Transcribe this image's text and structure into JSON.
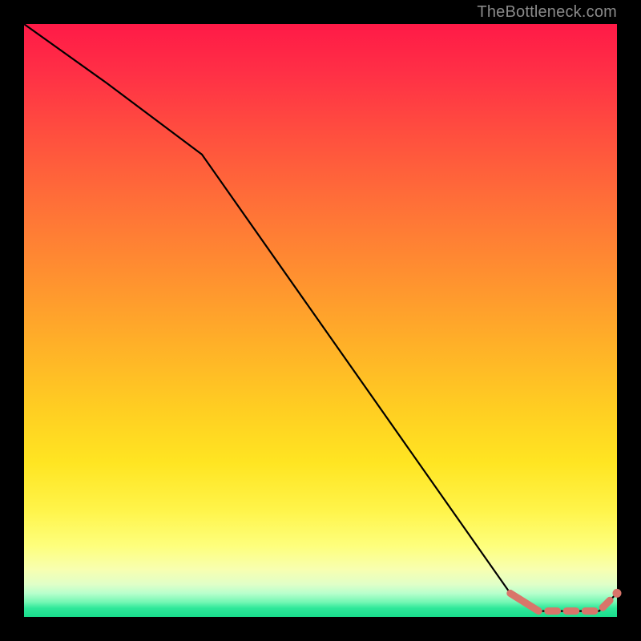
{
  "watermark": "TheBottleneck.com",
  "chart_data": {
    "type": "line",
    "title": "",
    "xlabel": "",
    "ylabel": "",
    "xlim": [
      0,
      100
    ],
    "ylim": [
      0,
      100
    ],
    "grid": false,
    "series": [
      {
        "name": "bottleneck-curve",
        "x": [
          0,
          14,
          30,
          82,
          86,
          97,
          100
        ],
        "y": [
          100,
          90,
          78,
          4,
          1,
          1,
          4
        ]
      }
    ],
    "highlight_segment": {
      "name": "bottom-highlight",
      "style": "thick-dashed",
      "color": "#d9756a",
      "x": [
        82,
        86,
        97,
        100
      ],
      "y": [
        4,
        1,
        1,
        4
      ]
    },
    "end_marker": {
      "x": 100,
      "y": 4,
      "color": "#d9756a"
    },
    "gradient_bands": [
      {
        "pos": 0.0,
        "color": "#ff1a47"
      },
      {
        "pos": 0.5,
        "color": "#ffb028"
      },
      {
        "pos": 0.82,
        "color": "#fff44a"
      },
      {
        "pos": 0.96,
        "color": "#b8ffcc"
      },
      {
        "pos": 1.0,
        "color": "#18dd8c"
      }
    ]
  }
}
